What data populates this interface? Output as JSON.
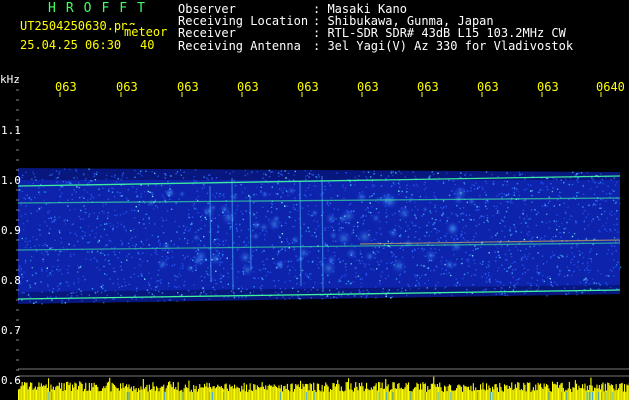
{
  "header": {
    "app_name": "HROFFT",
    "filename": "UT2504250630.png",
    "tag": "meteor",
    "datetime": "25.04.25 06:30",
    "count": "40",
    "info": [
      {
        "key": "Observer",
        "value": ": Masaki Kano"
      },
      {
        "key": "Receiving Location",
        "value": ": Shibukawa, Gunma, Japan"
      },
      {
        "key": "Receiver",
        "value": ": RTL-SDR SDR# 43dB L15 103.2MHz CW"
      },
      {
        "key": "Receiving Antenna",
        "value": ": 3el Yagi(V) Az 330 for Vladivostok"
      }
    ]
  },
  "colors": {
    "yellow": "#ffff00",
    "white": "#ffffff",
    "band": "#1a3aff",
    "band_light": "#3ab0ff",
    "streak": "#40ffa0"
  },
  "spectrogram": {
    "freq_unit": "kHz",
    "freq_ticks": [
      "1.1",
      "1.0",
      "0.9",
      "0.8",
      "0.7",
      "0.6"
    ],
    "time_ticks": [
      "063",
      "063",
      "063",
      "063",
      "063",
      "063",
      "063",
      "063",
      "063",
      "0640"
    ]
  }
}
